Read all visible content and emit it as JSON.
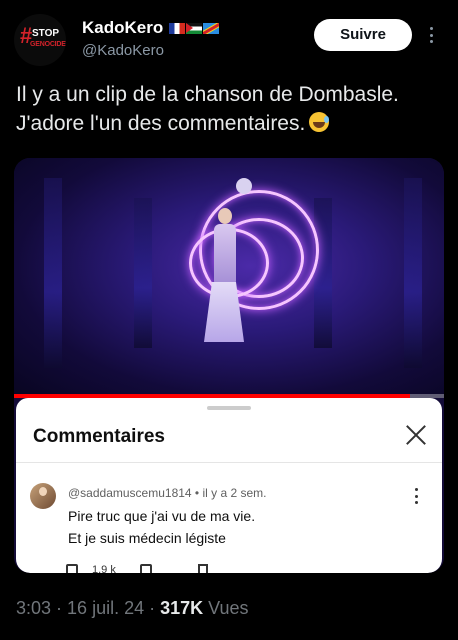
{
  "header": {
    "avatar_text_top": "STOP",
    "avatar_text_bottom": "GENOCIDE",
    "display_name": "KadoKero",
    "handle": "@KadoKero",
    "follow_label": "Suivre"
  },
  "tweet": {
    "line1": "Il y a un clip de la chanson de Dombasle.",
    "line2": "J'adore l'un des commentaires."
  },
  "media": {
    "progress": 0.92,
    "comments_sheet": {
      "title": "Commentaires",
      "comment": {
        "meta": "@saddamuscemu1814 • il y a 2 sem.",
        "line1": "Pire truc que j'ai vu de ma vie.",
        "line2": "Et je suis médecin légiste",
        "likes": "1,9 k"
      }
    }
  },
  "footer": {
    "time": "3:03",
    "date": "16 juil. 24",
    "views_count": "317K",
    "views_label": "Vues"
  },
  "colors": {
    "background": "#000000",
    "accent_red": "#ff0000",
    "follow_bg": "#ffffff"
  },
  "icons": [
    "flag-france-icon",
    "flag-palestine-icon",
    "flag-congo-icon",
    "laughing-emoji-icon",
    "close-icon",
    "more-vertical-icon",
    "like-icon",
    "reply-icon",
    "save-icon"
  ]
}
